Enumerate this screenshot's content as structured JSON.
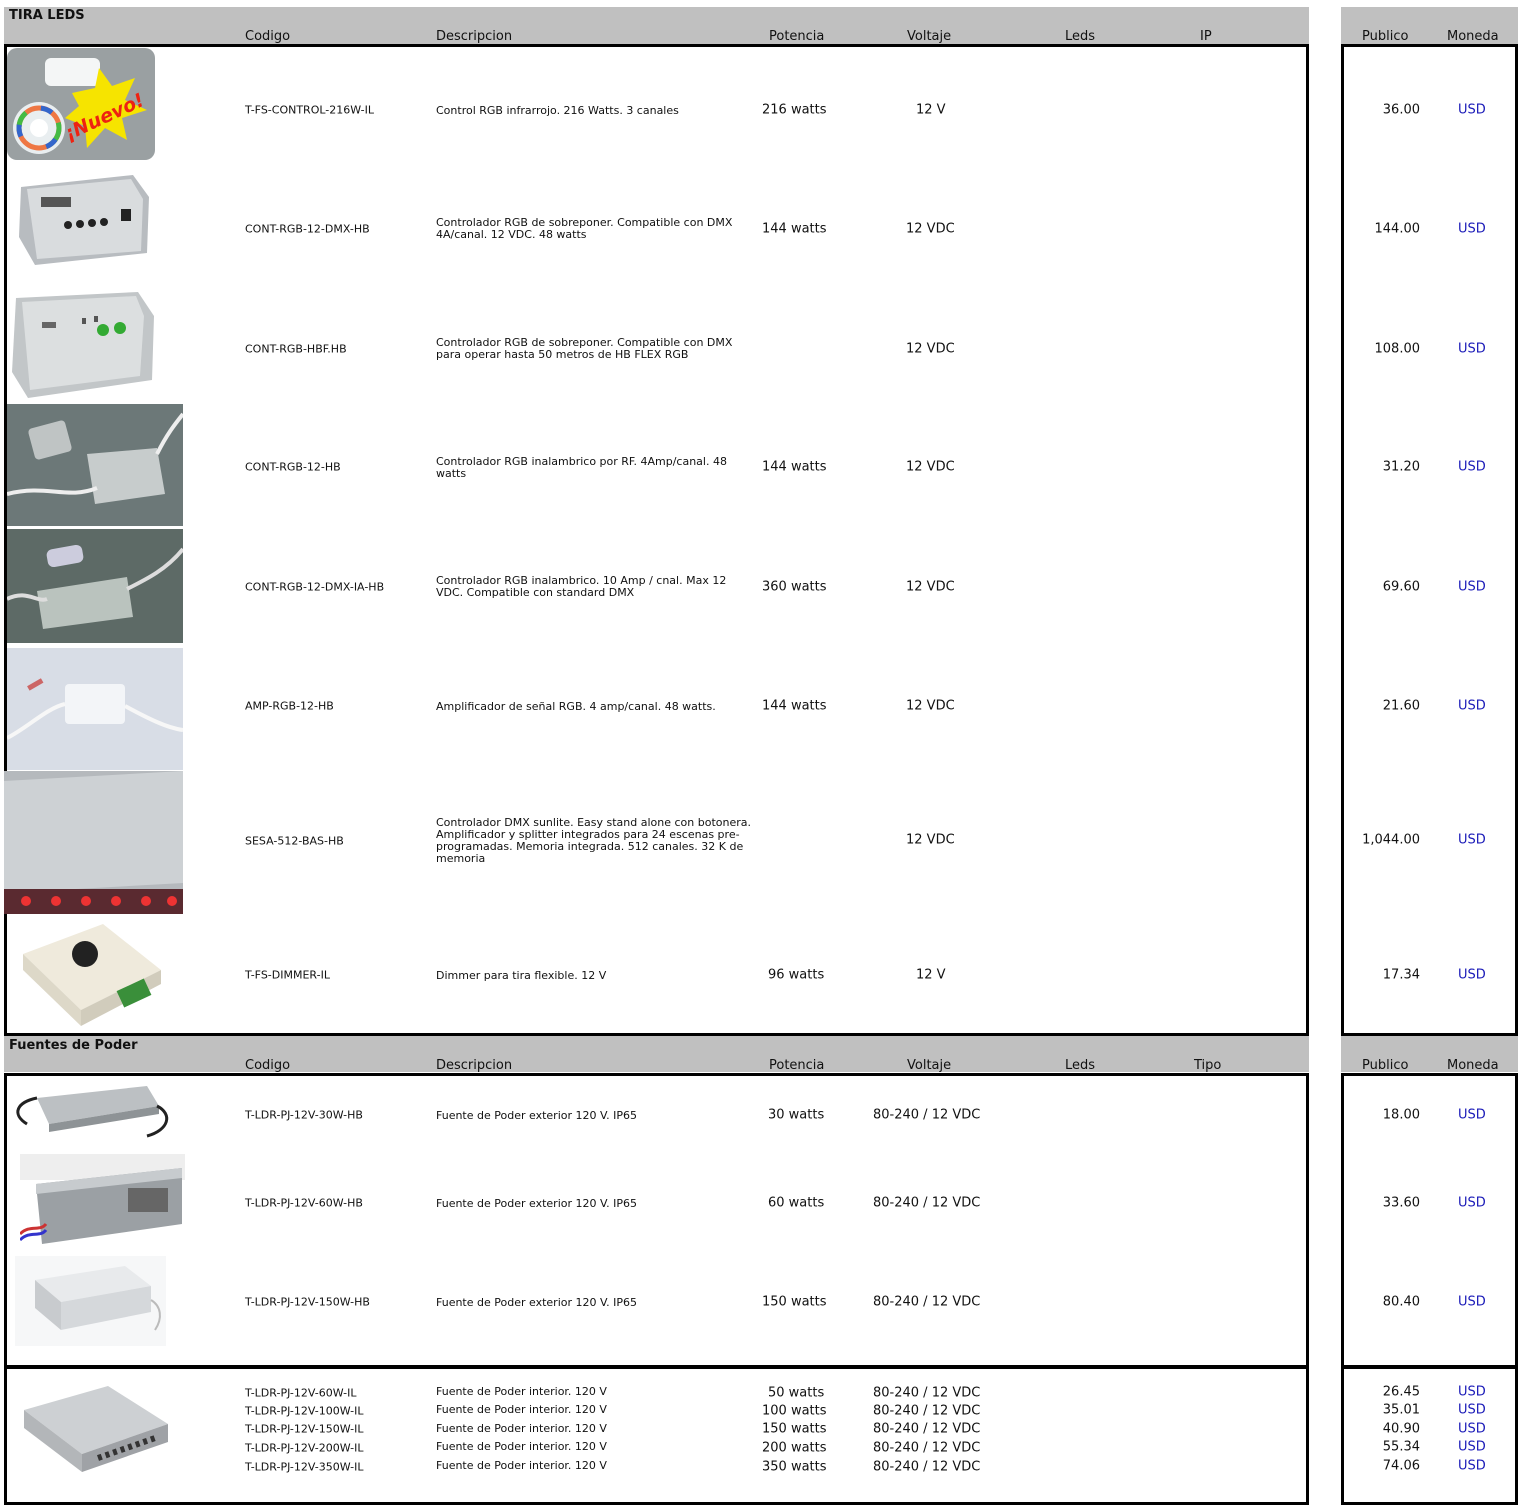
{
  "sections": [
    {
      "title": "TIRA LEDS",
      "headers": {
        "code": "Codigo",
        "desc": "Descripcion",
        "power": "Potencia",
        "voltage": "Voltaje",
        "leds": "Leds",
        "extra": "IP",
        "price": "Publico",
        "currency": "Moneda"
      }
    },
    {
      "title": "Fuentes de Poder",
      "headers": {
        "code": "Codigo",
        "desc": "Descripcion",
        "power": "Potencia",
        "voltage": "Voltaje",
        "leds": "Leds",
        "extra": "Tipo",
        "price": "Publico",
        "currency": "Moneda"
      }
    }
  ],
  "products": [
    {
      "code": "T-FS-CONTROL-216W-IL",
      "desc": "Control RGB infrarrojo. 216 Watts. 3 canales",
      "power": "216 watts",
      "voltage": "12 V",
      "price": "36.00",
      "currency": "USD",
      "image": "rgb-controller-nuevo",
      "badge": "¡Nuevo!"
    },
    {
      "code": "CONT-RGB-12-DMX-HB",
      "desc": "Controlador RGB de sobreponer. Compatible con DMX 4A/canal. 12 VDC. 48 watts",
      "power": "144 watts",
      "voltage": "12 VDC",
      "price": "144.00",
      "currency": "USD",
      "image": "dmx-controller-panel"
    },
    {
      "code": "CONT-RGB-HBF.HB",
      "desc": "Controlador RGB de sobreponer. Compatible con DMX para operar hasta 50 metros de HB FLEX RGB",
      "power": "",
      "voltage": "12 VDC",
      "price": "108.00",
      "currency": "USD",
      "image": "dmx-controller-box"
    },
    {
      "code": "CONT-RGB-12-HB",
      "desc": "Controlador RGB inalambrico por RF. 4Amp/canal. 48 watts",
      "power": "144 watts",
      "voltage": "12 VDC",
      "price": "31.20",
      "currency": "USD",
      "image": "rf-controller"
    },
    {
      "code": "CONT-RGB-12-DMX-IA-HB",
      "desc": "Controlador RGB inalambrico. 10 Amp / cnal. Max 12 VDC. Compatible con standard DMX",
      "power": "360 watts",
      "voltage": "12 VDC",
      "price": "69.60",
      "currency": "USD",
      "image": "wireless-controller"
    },
    {
      "code": "AMP-RGB-12-HB",
      "desc": "Amplificador de señal RGB. 4 amp/canal. 48 watts.",
      "power": "144 watts",
      "voltage": "12 VDC",
      "price": "21.60",
      "currency": "USD",
      "image": "rgb-amplifier"
    },
    {
      "code": "SESA-512-BAS-HB",
      "desc": "Controlador DMX sunlite. Easy stand alone con botonera. Amplificador y splitter integrados para 24 escenas pre-programadas. Memoria integrada. 512 canales. 32 K de memoria",
      "power": "",
      "voltage": "12 VDC",
      "price": "1,044.00",
      "currency": "USD",
      "image": "dmx-sunlite-box"
    },
    {
      "code": "T-FS-DIMMER-IL",
      "desc": "Dimmer para tira flexible. 12 V",
      "power": "96 watts",
      "voltage": "12 V",
      "price": "17.34",
      "currency": "USD",
      "image": "dimmer-knob"
    },
    {
      "code": "T-LDR-PJ-12V-30W-HB",
      "desc": "Fuente de Poder exterior 120 V. IP65",
      "power": "30 watts",
      "voltage": "80-240 / 12 VDC",
      "price": "18.00",
      "currency": "USD",
      "image": "psu-30w"
    },
    {
      "code": "T-LDR-PJ-12V-60W-HB",
      "desc": "Fuente de Poder exterior 120 V. IP65",
      "power": "60 watts",
      "voltage": "80-240 / 12 VDC",
      "price": "33.60",
      "currency": "USD",
      "image": "psu-60w"
    },
    {
      "code": "T-LDR-PJ-12V-150W-HB",
      "desc": "Fuente de Poder exterior 120 V. IP65",
      "power": "150 watts",
      "voltage": "80-240 / 12 VDC",
      "price": "80.40",
      "currency": "USD",
      "image": "psu-150w"
    },
    {
      "code": "T-LDR-PJ-12V-60W-IL",
      "desc": "Fuente de Poder interior. 120 V",
      "power": "50 watts",
      "voltage": "80-240 / 12 VDC",
      "price": "26.45",
      "currency": "USD"
    },
    {
      "code": "T-LDR-PJ-12V-100W-IL",
      "desc": "Fuente de Poder interior. 120 V",
      "power": "100 watts",
      "voltage": "80-240 / 12 VDC",
      "price": "35.01",
      "currency": "USD"
    },
    {
      "code": "T-LDR-PJ-12V-150W-IL",
      "desc": "Fuente de Poder interior. 120 V",
      "power": "150 watts",
      "voltage": "80-240 / 12 VDC",
      "price": "40.90",
      "currency": "USD"
    },
    {
      "code": "T-LDR-PJ-12V-200W-IL",
      "desc": "Fuente de Poder interior. 120 V",
      "power": "200 watts",
      "voltage": "80-240 / 12 VDC",
      "price": "55.34",
      "currency": "USD"
    },
    {
      "code": "T-LDR-PJ-12V-350W-IL",
      "desc": "Fuente de Poder interior. 120 V",
      "power": "350 watts",
      "voltage": "80-240 / 12 VDC",
      "price": "74.06",
      "currency": "USD"
    }
  ],
  "colors": {
    "header_bg": "#c0c0c0",
    "currency": "#1a1ab8",
    "border": "#000000"
  }
}
